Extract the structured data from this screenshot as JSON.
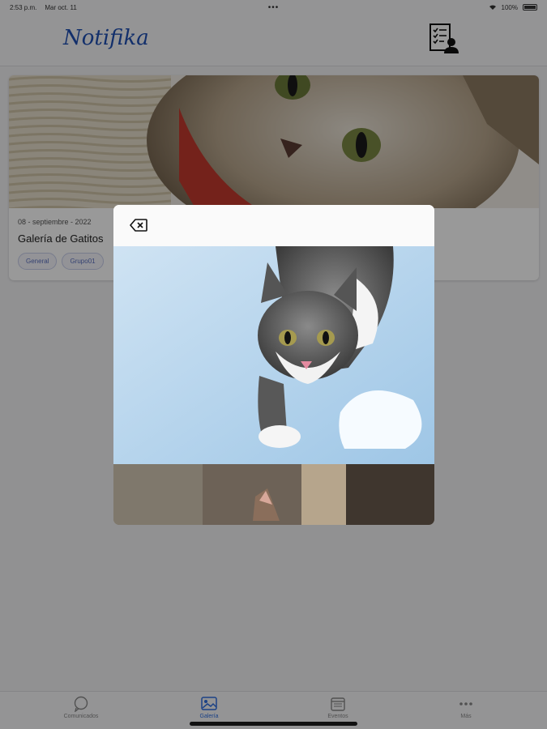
{
  "status": {
    "time": "2:53 p.m.",
    "date": "Mar oct. 11",
    "dots": "•••",
    "battery_text": "100%"
  },
  "app": {
    "logo": "Notifika",
    "profile_icon": "contact-list-icon"
  },
  "card": {
    "date": "08 - septiembre - 2022",
    "title": "Galería de Gatitos",
    "tags": [
      "General",
      "Grupo01"
    ]
  },
  "modal": {
    "close_icon": "backspace-x-icon"
  },
  "tabs": [
    {
      "label": "Comunicados",
      "icon": "chat-bubble-icon"
    },
    {
      "label": "Galería",
      "icon": "gallery-icon",
      "active": true
    },
    {
      "label": "Eventos",
      "icon": "calendar-icon"
    },
    {
      "label": "Más",
      "icon": "more-dots-icon"
    }
  ],
  "colors": {
    "brand": "#1f4fb3",
    "active_tab": "#2f6fe0",
    "tag_text": "#5a6fbf"
  }
}
